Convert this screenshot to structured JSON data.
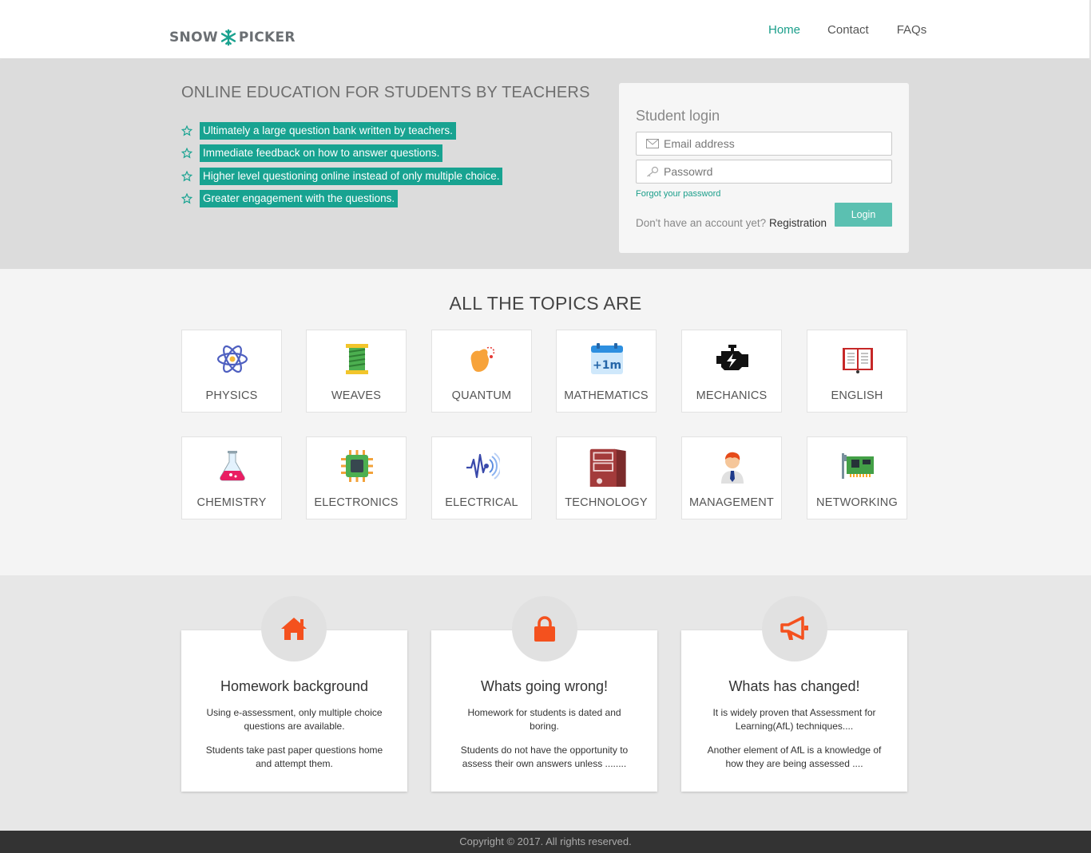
{
  "brand": {
    "name_left": "SNOW",
    "name_right": "PICKER"
  },
  "nav": {
    "home": "Home",
    "contact": "Contact",
    "faqs": "FAQs"
  },
  "hero": {
    "title": "ONLINE EDUCATION FOR STUDENTS BY TEACHERS",
    "features": [
      "Ultimately a large question bank written by teachers.",
      "Immediate feedback on how to answer questions.",
      "Higher level questioning online instead of only multiple choice.",
      "Greater engagement with the questions."
    ]
  },
  "login": {
    "title": "Student login",
    "email_placeholder": "Email address",
    "password_placeholder": "Passowrd",
    "forgot": "Forgot your password",
    "no_account": "Don't have an account yet?",
    "register": "Registration",
    "button": "Login"
  },
  "topics": {
    "title": "ALL THE TOPICS ARE",
    "items": [
      {
        "label": "PHYSICS",
        "icon": "atom-icon"
      },
      {
        "label": "WEAVES",
        "icon": "thread-spool-icon"
      },
      {
        "label": "QUANTUM",
        "icon": "quantum-hand-icon"
      },
      {
        "label": "MATHEMATICS",
        "icon": "calendar-plus-one-month-icon"
      },
      {
        "label": "MECHANICS",
        "icon": "engine-icon"
      },
      {
        "label": "ENGLISH",
        "icon": "open-book-icon"
      },
      {
        "label": "CHEMISTRY",
        "icon": "flask-icon"
      },
      {
        "label": "ELECTRONICS",
        "icon": "chip-icon"
      },
      {
        "label": "ELECTRICAL",
        "icon": "signal-wave-icon"
      },
      {
        "label": "TECHNOLOGY",
        "icon": "server-tower-icon"
      },
      {
        "label": "MANAGEMENT",
        "icon": "manager-person-icon"
      },
      {
        "label": "NETWORKING",
        "icon": "network-card-icon"
      }
    ]
  },
  "icon_labels": {
    "mathematics_badge": "+1m"
  },
  "info": {
    "cards": [
      {
        "icon": "home-icon",
        "title": "Homework background",
        "p1": "Using e-assessment, only multiple choice questions are available.",
        "p2": "Students take past paper questions home and attempt them."
      },
      {
        "icon": "lock-icon",
        "title": "Whats going wrong!",
        "p1": "Homework for students is dated and boring.",
        "p2": "Students do not have the opportunity to assess their own answers unless ........"
      },
      {
        "icon": "megaphone-icon",
        "title": "Whats has changed!",
        "p1": "It is widely proven that Assessment for Learning(AfL) techniques....",
        "p2": "Another element of AfL is a knowledge of how they are being assessed ...."
      }
    ]
  },
  "footer": {
    "copyright": "Copyright © 2017. All rights reserved."
  },
  "colors": {
    "accent": "#18a391",
    "login_button": "#5bc0b1",
    "info_icon": "#f4511e",
    "footer": "#333333"
  }
}
